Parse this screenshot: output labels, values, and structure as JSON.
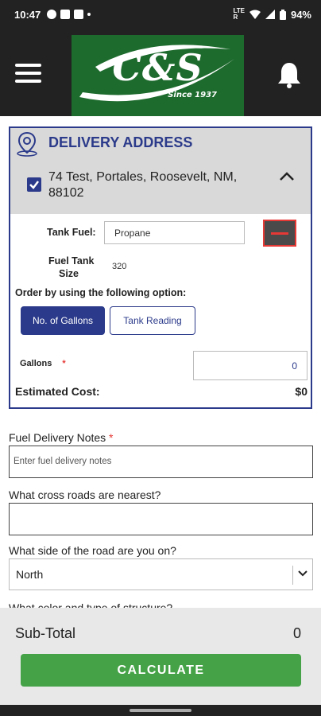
{
  "status_bar": {
    "time": "10:47",
    "battery": "94%"
  },
  "header": {
    "logo_text": "C&S",
    "logo_sub": "Since 1937"
  },
  "delivery": {
    "title": "DELIVERY ADDRESS",
    "address": "74 Test, Portales, Roosevelt, NM, 88102",
    "tank_fuel_label": "Tank Fuel:",
    "tank_fuel_value": "Propane",
    "tank_size_label_1": "Fuel Tank",
    "tank_size_label_2": "Size",
    "tank_size_value": "320",
    "order_option_label": "Order by using the following option:",
    "option_gallons": "No. of Gallons",
    "option_tank_reading": "Tank Reading",
    "gallons_label": "Gallons",
    "required_mark": "*",
    "gallons_value": "0",
    "estimated_cost_label": "Estimated Cost:",
    "estimated_cost_value": "$0"
  },
  "form": {
    "notes_label": "Fuel Delivery Notes",
    "notes_placeholder": "Enter fuel delivery notes",
    "cross_roads_label": "What cross roads are nearest?",
    "side_label": "What side of the road are you on?",
    "side_value": "North",
    "color_label": "What color and type of structure?"
  },
  "footer": {
    "subtotal_label": "Sub-Total",
    "subtotal_value": "0",
    "calculate_label": "CALCULATE"
  },
  "colors": {
    "brand_green": "#1e6b2e",
    "accent_blue": "#2b3a8a",
    "button_green": "#45a247",
    "alert_red": "#e53935"
  }
}
